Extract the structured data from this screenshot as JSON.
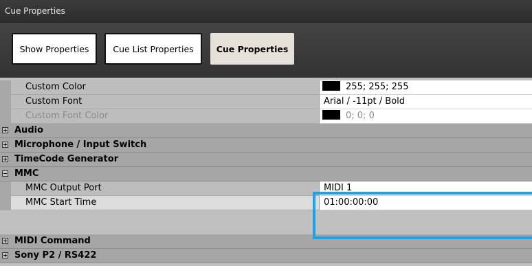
{
  "window": {
    "title": "Cue Properties"
  },
  "tabs": [
    {
      "label": "Show Properties",
      "active": false
    },
    {
      "label": "Cue List Properties",
      "active": false
    },
    {
      "label": "Cue Properties",
      "active": true
    }
  ],
  "grid": {
    "custom_color": {
      "label": "Custom Color",
      "value": "255; 255; 255",
      "swatch": "#000000"
    },
    "custom_font": {
      "label": "Custom Font",
      "value": "Arial / -11pt / Bold"
    },
    "custom_font_color": {
      "label": "Custom Font Color",
      "value": "0; 0; 0",
      "swatch": "#000000"
    },
    "cat_audio": "Audio",
    "cat_microphone": "Microphone / Input Switch",
    "cat_timecode": "TimeCode Generator",
    "cat_mmc": "MMC",
    "mmc_output_port": {
      "label": "MMC Output Port",
      "value": "MIDI 1"
    },
    "mmc_start_time": {
      "label": "MMC Start Time",
      "value": "01:00:00:00"
    },
    "cat_midi": "MIDI Command",
    "cat_sony": "Sony P2 / RS422"
  },
  "colors": {
    "highlight": "#1aa3e8",
    "active_tab": "#e5e1d8"
  }
}
